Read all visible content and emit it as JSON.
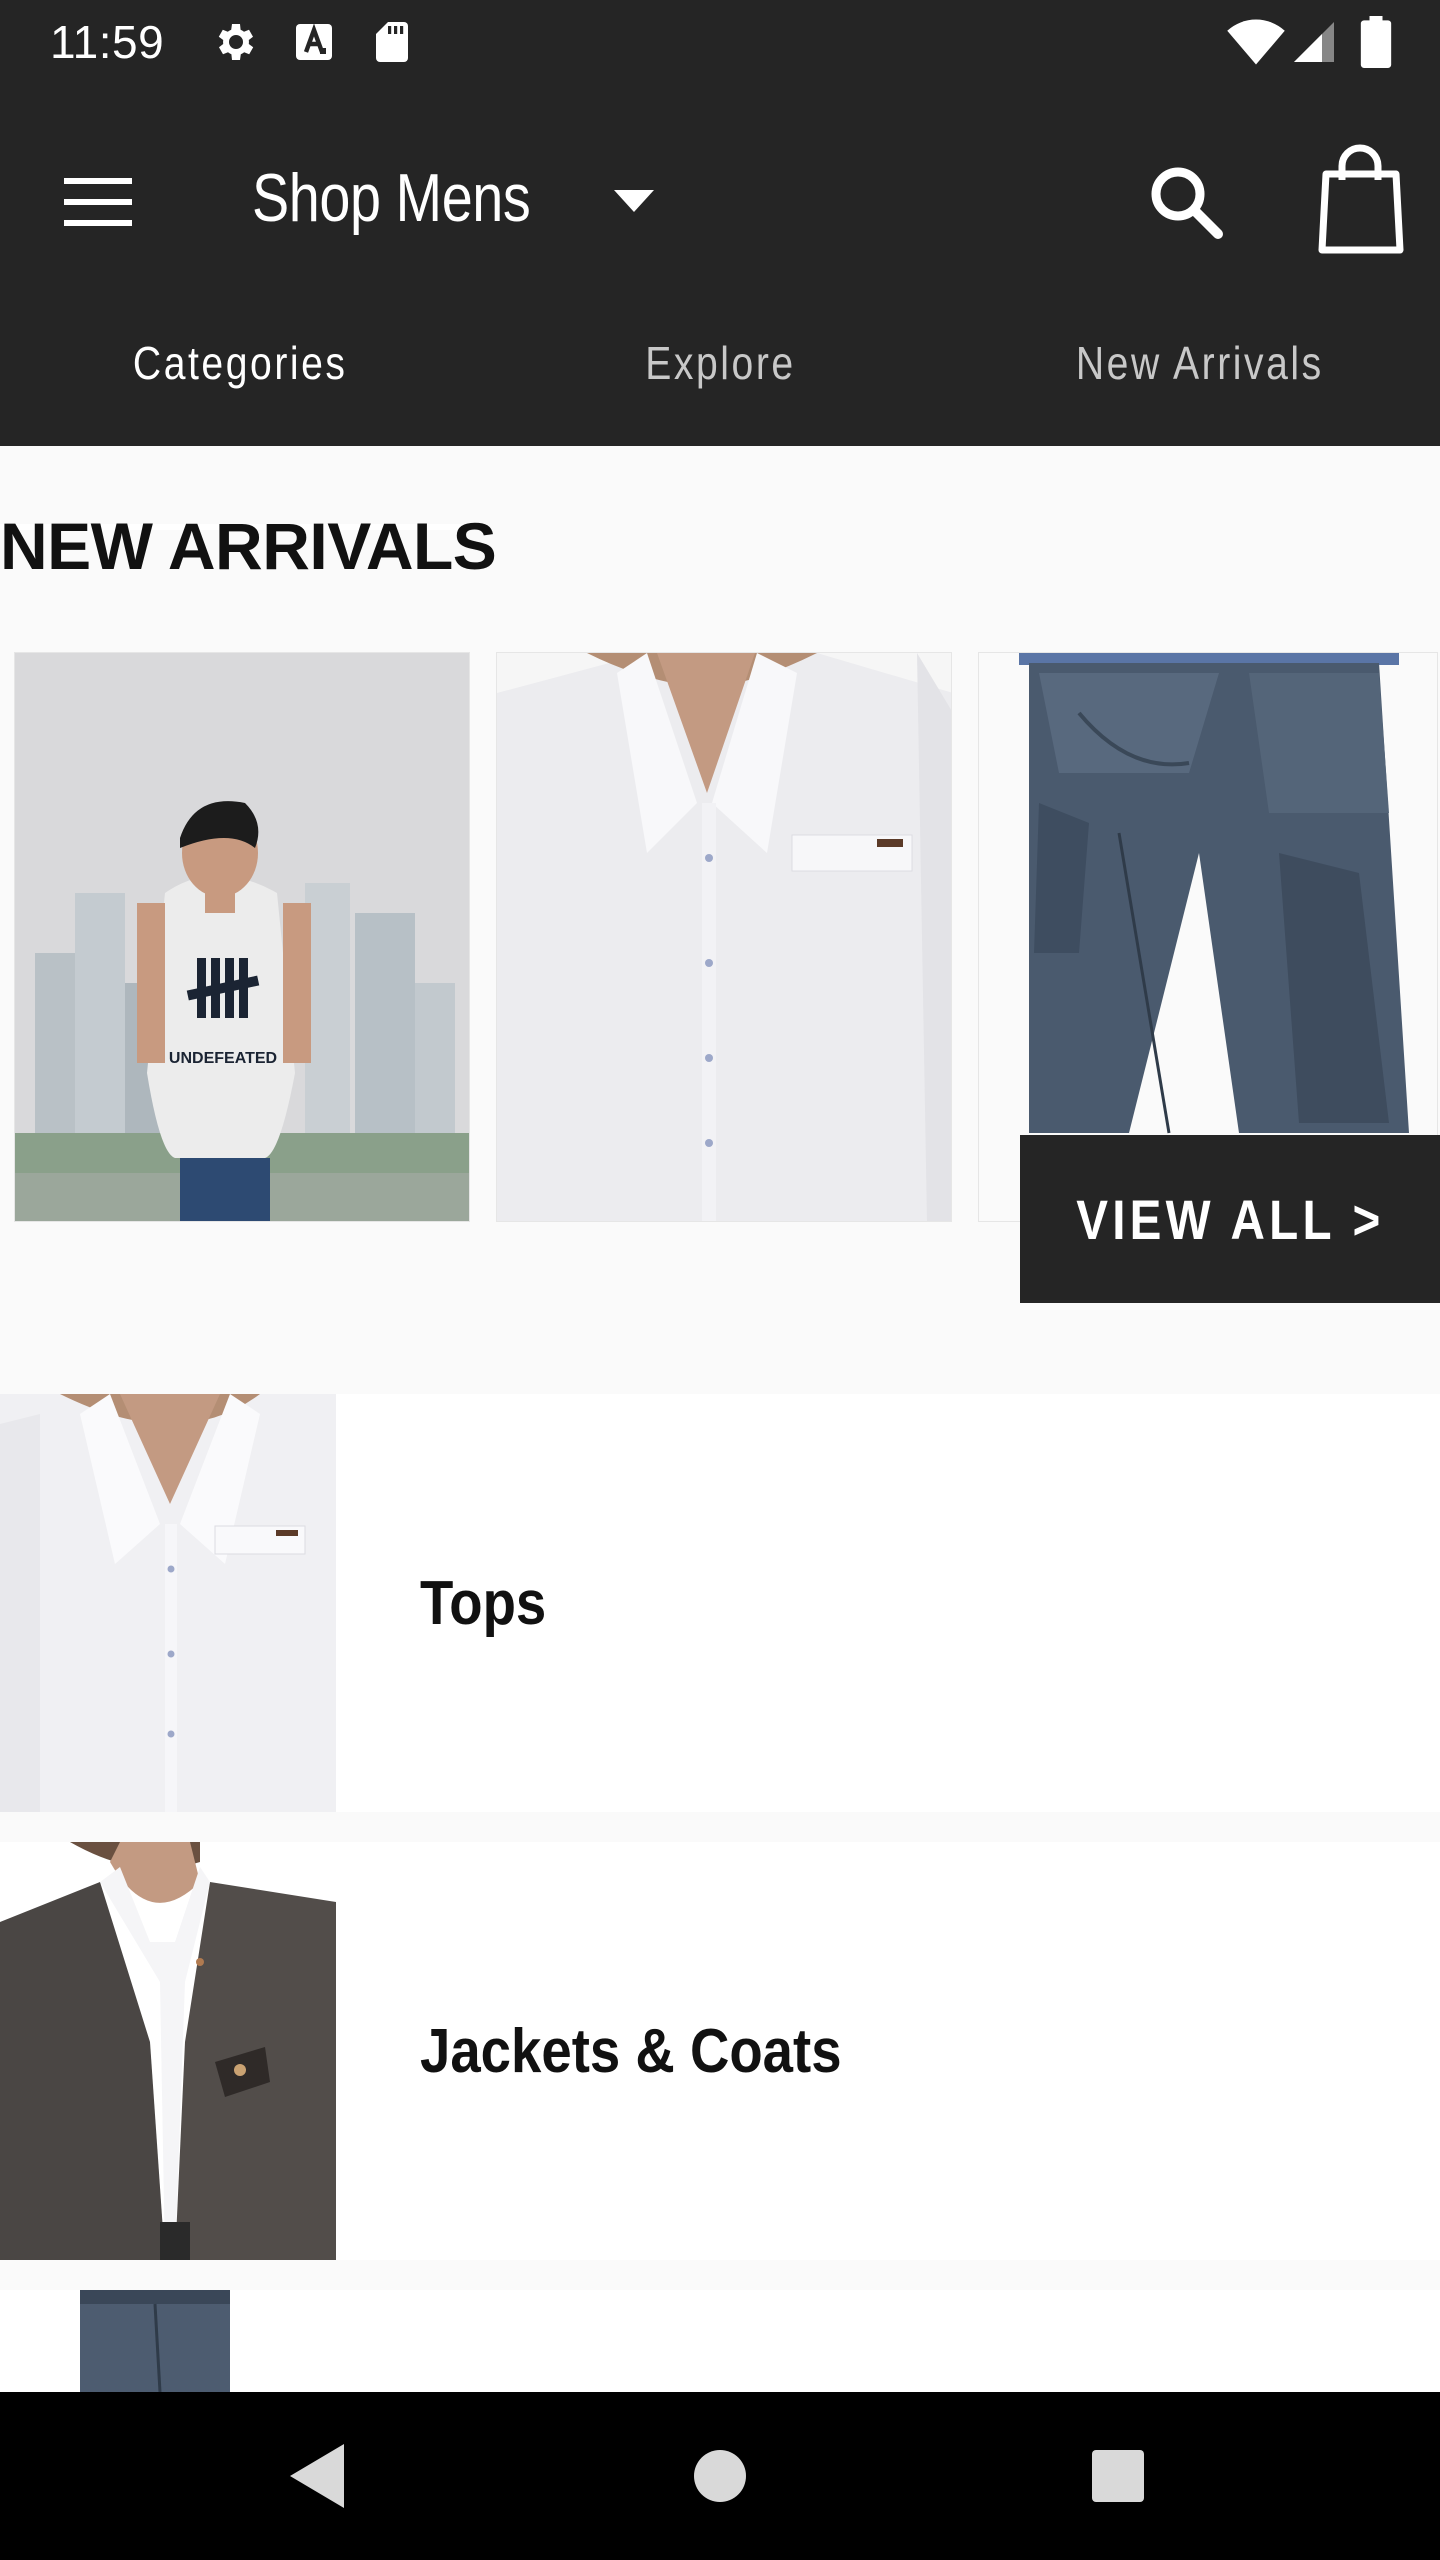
{
  "status_bar": {
    "time": "11:59",
    "icons": [
      "gear-icon",
      "a-notification-icon",
      "sd-card-icon",
      "wifi-icon",
      "cell-signal-icon",
      "battery-icon"
    ]
  },
  "app_bar": {
    "menu_icon": "hamburger-menu-icon",
    "title": "Shop Mens",
    "dropdown_icon": "dropdown-arrow-icon",
    "search_icon": "search-icon",
    "bag_icon": "shopping-bag-icon"
  },
  "tabs": [
    {
      "label": "Categories",
      "active": true
    },
    {
      "label": "Explore",
      "active": false
    },
    {
      "label": "New Arrivals",
      "active": false
    }
  ],
  "new_arrivals": {
    "title": "NEW ARRIVALS",
    "tshirt_print": "UNDEFEATED",
    "view_all_label": "VIEW ALL  >"
  },
  "categories": [
    {
      "label": "Tops"
    },
    {
      "label": "Jackets & Coats"
    }
  ],
  "colors": {
    "app_bar": "#252525",
    "background": "#fafafa",
    "text": "#111111",
    "accent": "#ffffff"
  }
}
